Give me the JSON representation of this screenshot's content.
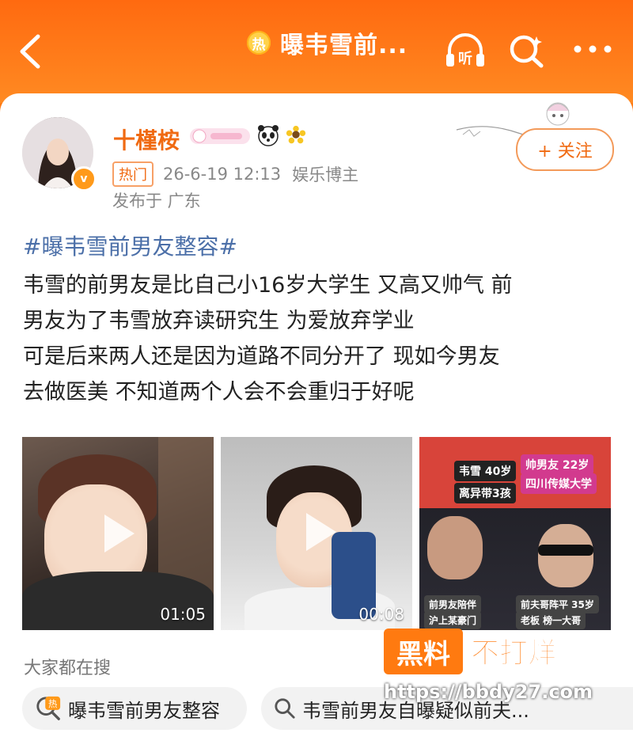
{
  "header": {
    "hot_icon": "热",
    "topic_title": "曝韦雪前...",
    "listen_label": "听"
  },
  "post": {
    "username": "十槿桉",
    "hot_tag": "热门",
    "date": "26-6-19 12:13",
    "role": "娱乐博主",
    "location": "发布于 广东",
    "follow_label": "+ 关注",
    "hashtag": "#曝韦雪前男友整容#",
    "body_lines": [
      "韦雪的前男友是比自己小16岁大学生 又高又帅气 前",
      "男友为了韦雪放弃读研究生 为爱放弃学业",
      "可是后来两人还是因为道路不同分开了 现如今男友",
      "去做医美 不知道两个人会不会重归于好呢"
    ]
  },
  "media": {
    "videos": [
      {
        "duration": "01:05"
      },
      {
        "duration": "00:08"
      }
    ],
    "image_labels": [
      "韦雪 40岁",
      "离异带3孩",
      "帅男友 22岁",
      "四川传媒大学",
      "前男友陪伴",
      "沪上某豪门",
      "前夫哥阵平 35岁",
      "老板 榜一大哥"
    ]
  },
  "search": {
    "title": "大家都在搜",
    "chips": [
      {
        "icon": "热",
        "text": "曝韦雪前男友整容"
      },
      {
        "text": "韦雪前男友自曝疑似前夫..."
      }
    ]
  },
  "watermark": {
    "badge": "黑料",
    "text": "不打烊",
    "url": "https://bbdy27.com"
  },
  "colors": {
    "accent": "#ff7a14",
    "username": "#f06a12",
    "hashtag": "#4b6fa8"
  }
}
